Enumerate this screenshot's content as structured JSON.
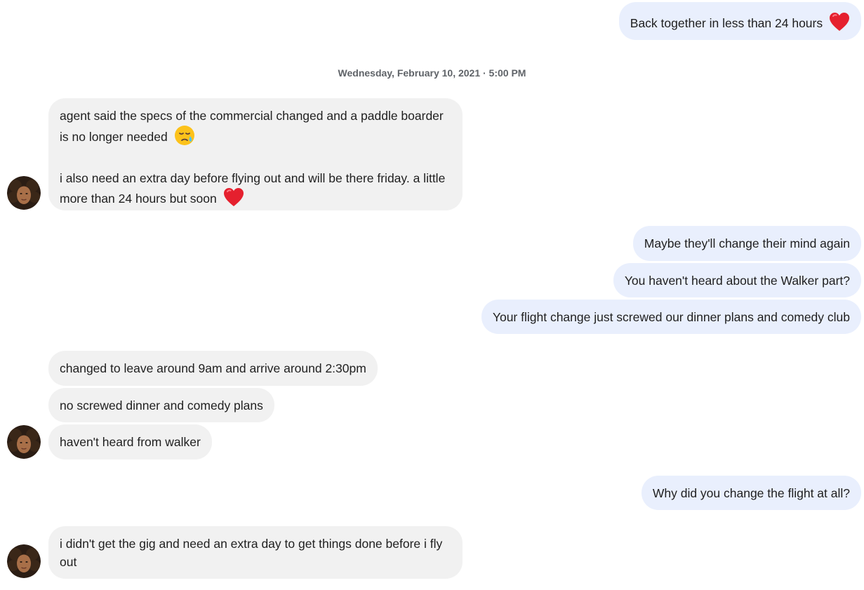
{
  "messages": {
    "m1": {
      "text": "Back together in less than 24 hours",
      "emoji": "red-heart"
    },
    "timestamp": "Wednesday, February 10, 2021 · 5:00 PM",
    "m2": {
      "line1": "agent said the specs of the commercial changed and a paddle boarder is no longer needed",
      "line1_emoji": "sad-relieved-face",
      "line2": "i also need an extra day before flying out and will be there friday. a little more than 24 hours but soon",
      "line2_emoji": "red-heart"
    },
    "m3": {
      "text": "Maybe they'll change their mind again"
    },
    "m4": {
      "text": "You haven't heard about the Walker part?"
    },
    "m5": {
      "text": "Your flight change just screwed our dinner plans and comedy club"
    },
    "m6": {
      "text": "changed to leave around 9am and arrive around 2:30pm"
    },
    "m7": {
      "text": "no screwed dinner and comedy plans"
    },
    "m8": {
      "text": "haven't heard from walker"
    },
    "m9": {
      "text": "Why did you change the flight at all?"
    },
    "m10": {
      "text": "i didn't get the gig and need an extra day to get things done before i fly out"
    }
  },
  "colors": {
    "outgoing_bubble": "#e9effd",
    "incoming_bubble": "#f1f1f1",
    "timestamp_text": "#5f6368"
  }
}
